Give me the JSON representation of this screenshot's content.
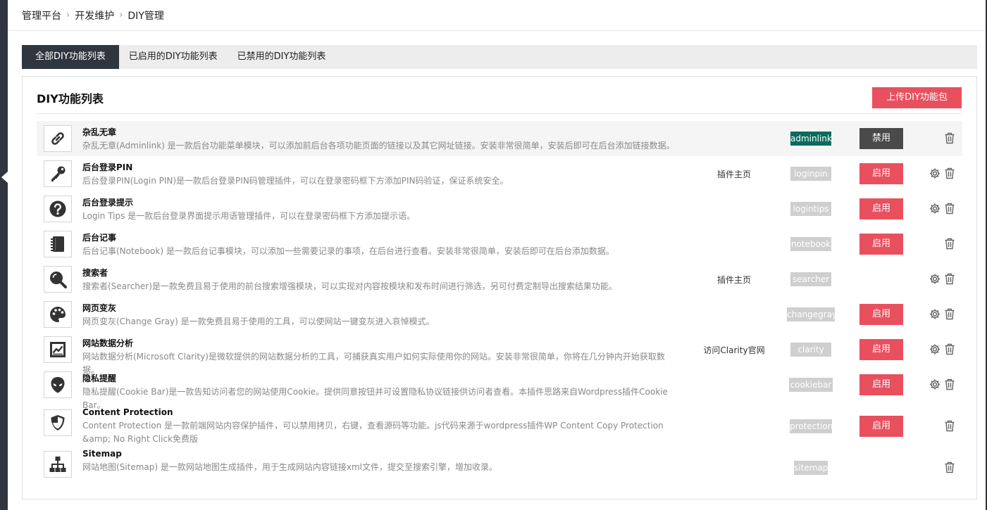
{
  "breadcrumb": [
    "管理平台",
    "开发维护",
    "DIY管理"
  ],
  "tabs": [
    "全部DIY功能列表",
    "已启用的DIY功能列表",
    "已禁用的DIY功能列表"
  ],
  "panel": {
    "title": "DIY功能列表",
    "upload_label": "上传DIY功能包"
  },
  "items": [
    {
      "name": "杂乱无章",
      "desc": "杂乱无章(Adminlink) 是一款后台功能菜单模块，可以添加前后台各项功能页面的链接以及其它网址链接。安装非常很简单，安装后即可在后台添加链接数据。",
      "link": "",
      "tag": "adminlink",
      "action": "禁用",
      "icon": "link-icon"
    },
    {
      "name": "后台登录PIN",
      "desc": "后台登录PIN(Login PIN)是一款后台登录PIN码管理插件，可以在登录密码框下方添加PIN码验证，保证系统安全。",
      "link": "插件主页",
      "tag": "loginpin",
      "action": "启用",
      "icon": "key-icon"
    },
    {
      "name": "后台登录提示",
      "desc": "Login Tips 是一款后台登录界面提示用语管理插件，可以在登录密码框下方添加提示语。",
      "link": "",
      "tag": "logintips",
      "action": "启用",
      "icon": "question-icon"
    },
    {
      "name": "后台记事",
      "desc": "后台记事(Notebook) 是一款后台记事模块，可以添加一些需要记录的事项，在后台进行查看。安装非常很简单，安装后即可在后台添加数据。",
      "link": "",
      "tag": "notebook",
      "action": "启用",
      "icon": "notebook-icon"
    },
    {
      "name": "搜索者",
      "desc": "搜索者(Searcher)是一款免费且易于使用的前台搜索增强模块，可以实现对内容按模块和发布时间进行筛选，另可付费定制导出搜索结果功能。",
      "link": "插件主页",
      "tag": "searcher",
      "action": "",
      "icon": "search-icon"
    },
    {
      "name": "网页变灰",
      "desc": "网页变灰(Change Gray) 是一款免费且易于使用的工具，可以使网站一键变灰进入哀悼模式。",
      "link": "",
      "tag": "changegray",
      "action": "启用",
      "icon": "palette-icon"
    },
    {
      "name": "网站数据分析",
      "desc": "网站数据分析(Microsoft Clarity)是微软提供的网站数据分析的工具，可捕获真实用户如何实际使用你的网站。安装非常很简单，你将在几分钟内开始获取数据。",
      "link": "访问Clarity官网",
      "tag": "clarity",
      "action": "启用",
      "icon": "chart-icon"
    },
    {
      "name": "隐私提醒",
      "desc": "隐私提醒(Cookie Bar)是一款告知访问者您的网站使用Cookie。提供同意按钮并可设置隐私协议链接供访问者查看。本插件思路来自Wordpress插件Cookie Bar。",
      "link": "",
      "tag": "cookiebar",
      "action": "启用",
      "icon": "alien-icon"
    },
    {
      "name": "Content Protection",
      "desc": "Content Protection 是一款前端网站内容保护插件，可以禁用拷贝，右键，查看源码等功能。js代码来源于wordpress插件WP Content Copy Protection &amp; No Right Click免费版",
      "link": "",
      "tag": "protection",
      "action": "启用",
      "icon": "shield-icon"
    },
    {
      "name": "Sitemap",
      "desc": "网站地图(Sitemap) 是一款网站地图生成插件，用于生成网站内容链接xml文件，提交至搜索引擎，增加收录。",
      "link": "",
      "tag": "sitemap",
      "action": "",
      "icon": "sitemap-icon"
    }
  ]
}
